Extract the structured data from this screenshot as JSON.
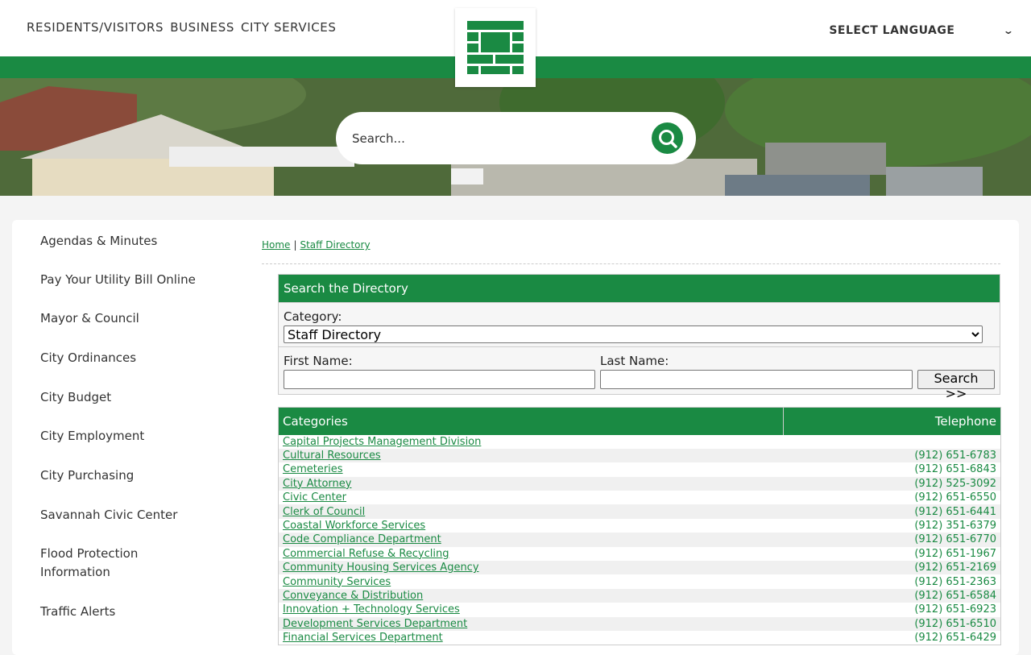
{
  "header": {
    "nav": [
      "RESIDENTS/VISITORS",
      "BUSINESS",
      "CITY SERVICES"
    ],
    "language_label": "SELECT LANGUAGE"
  },
  "search": {
    "placeholder": "Search..."
  },
  "sidebar": {
    "items": [
      "Agendas & Minutes",
      "Pay Your Utility Bill Online",
      "Mayor & Council",
      "City Ordinances",
      "City Budget",
      "City Employment",
      "City Purchasing",
      "Savannah Civic Center",
      "Flood Protection Information",
      "Traffic Alerts"
    ]
  },
  "breadcrumb": {
    "home": "Home",
    "separator": "|",
    "current": "Staff Directory"
  },
  "directory": {
    "title": "Search the Directory",
    "category_label": "Category:",
    "category_value": "Staff Directory",
    "first_name_label": "First Name:",
    "last_name_label": "Last Name:",
    "search_button": "Search >>"
  },
  "categories": {
    "header_name": "Categories",
    "header_tel": "Telephone",
    "rows": [
      {
        "name": "Capital Projects Management Division",
        "tel": ""
      },
      {
        "name": "Cultural Resources",
        "tel": "(912) 651-6783"
      },
      {
        "name": "Cemeteries",
        "tel": "(912) 651-6843"
      },
      {
        "name": "City Attorney",
        "tel": "(912) 525-3092"
      },
      {
        "name": "Civic Center",
        "tel": "(912) 651-6550"
      },
      {
        "name": "Clerk of Council",
        "tel": "(912) 651-6441"
      },
      {
        "name": "Coastal Workforce Services",
        "tel": "(912) 351-6379"
      },
      {
        "name": "Code Compliance Department",
        "tel": "(912) 651-6770"
      },
      {
        "name": "Commercial Refuse & Recycling",
        "tel": "(912) 651-1967"
      },
      {
        "name": "Community Housing Services Agency",
        "tel": "(912) 651-2169"
      },
      {
        "name": "Community Services",
        "tel": "(912) 651-2363"
      },
      {
        "name": "Conveyance & Distribution",
        "tel": "(912) 651-6584"
      },
      {
        "name": "Innovation + Technology Services",
        "tel": "(912) 651-6923"
      },
      {
        "name": "Development Services Department",
        "tel": "(912) 651-6510"
      },
      {
        "name": "Financial Services Department",
        "tel": "(912) 651-6429"
      }
    ]
  },
  "colors": {
    "brand": "#1a8a43"
  }
}
